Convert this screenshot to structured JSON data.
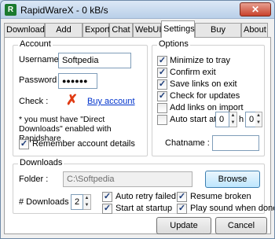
{
  "window": {
    "title": "RapidWareX - 0 kB/s",
    "close_glyph": "✕",
    "app_icon": "R"
  },
  "tabs": [
    {
      "label": "Downloads"
    },
    {
      "label": "Add Links"
    },
    {
      "label": "Export"
    },
    {
      "label": "Chat"
    },
    {
      "label": "WebUI"
    },
    {
      "label": "Settings",
      "active": true
    },
    {
      "label": "Buy Account"
    },
    {
      "label": "About"
    }
  ],
  "account": {
    "title": "Account",
    "username_label": "Username :",
    "username_value": "Softpedia",
    "password_label": "Password :",
    "password_value": "●●●●●●",
    "check_label": "Check :",
    "check_icon": "red-x-icon",
    "buy_link": "Buy account",
    "note": "* you must have \"Direct Downloads\" enabled with Rapidshare",
    "remember_label": "Remember account details",
    "remember_checked": true
  },
  "options": {
    "title": "Options",
    "items": [
      {
        "label": "Minimize to tray",
        "checked": true
      },
      {
        "label": "Confirm exit",
        "checked": true
      },
      {
        "label": "Save links on exit",
        "checked": true
      },
      {
        "label": "Check for updates",
        "checked": true
      },
      {
        "label": "Add links on import",
        "checked": false
      }
    ],
    "autostart_label": "Auto start at",
    "autostart_checked": false,
    "hour_value": "0",
    "hour_unit": "h",
    "minute_value": "0",
    "chatname_label": "Chatname :",
    "chatname_value": ""
  },
  "downloads": {
    "title": "Downloads",
    "folder_label": "Folder :",
    "folder_value": "C:\\Softpedia",
    "browse_label": "Browse",
    "count_label": "# Downloads :",
    "count_value": "2",
    "checks": [
      {
        "label": "Auto retry failed",
        "checked": true
      },
      {
        "label": "Resume broken",
        "checked": true
      },
      {
        "label": "Start at startup",
        "checked": true
      },
      {
        "label": "Play sound when done",
        "checked": true
      }
    ]
  },
  "footer": {
    "update_label": "Update",
    "cancel_label": "Cancel"
  },
  "colors": {
    "link": "#0033cc",
    "close_button": "#c8412c",
    "check_error": "#e03a12"
  }
}
